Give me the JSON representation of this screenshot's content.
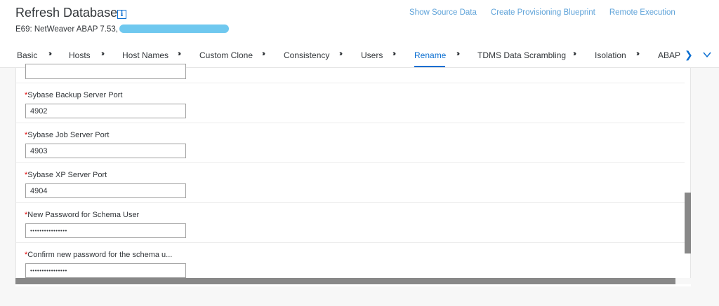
{
  "header": {
    "title": "Refresh Database",
    "subtitle": "E69: NetWeaver ABAP 7.53,",
    "actions": [
      "Show Source Data",
      "Create Provisioning Blueprint",
      "Remote Execution"
    ]
  },
  "tabs": [
    "Basic",
    "Hosts",
    "Host Names",
    "Custom Clone",
    "Consistency",
    "Users",
    "Rename",
    "TDMS Data Scrambling",
    "Isolation",
    "ABAP"
  ],
  "active_tab": "Rename",
  "separator": "›››",
  "icons": {
    "info": "info-icon",
    "scroll_right": "chevron-right-icon",
    "overflow": "chevron-down-icon"
  },
  "form": {
    "required_mark": "*",
    "fields": [
      {
        "label": "Sybase Backup Server Port",
        "value": "4902"
      },
      {
        "label": "Sybase Job Server Port",
        "value": "4903"
      },
      {
        "label": "Sybase XP Server Port",
        "value": "4904"
      },
      {
        "label": "New Password for Schema User",
        "value": "••••••••••••••••"
      },
      {
        "label": "Confirm new password for the schema u...",
        "value": "••••••••••••••••"
      }
    ]
  },
  "colors": {
    "accent": "#0a6ed1",
    "link": "#5fa3d9",
    "required": "#e00000",
    "scrollbar": "#888888"
  }
}
